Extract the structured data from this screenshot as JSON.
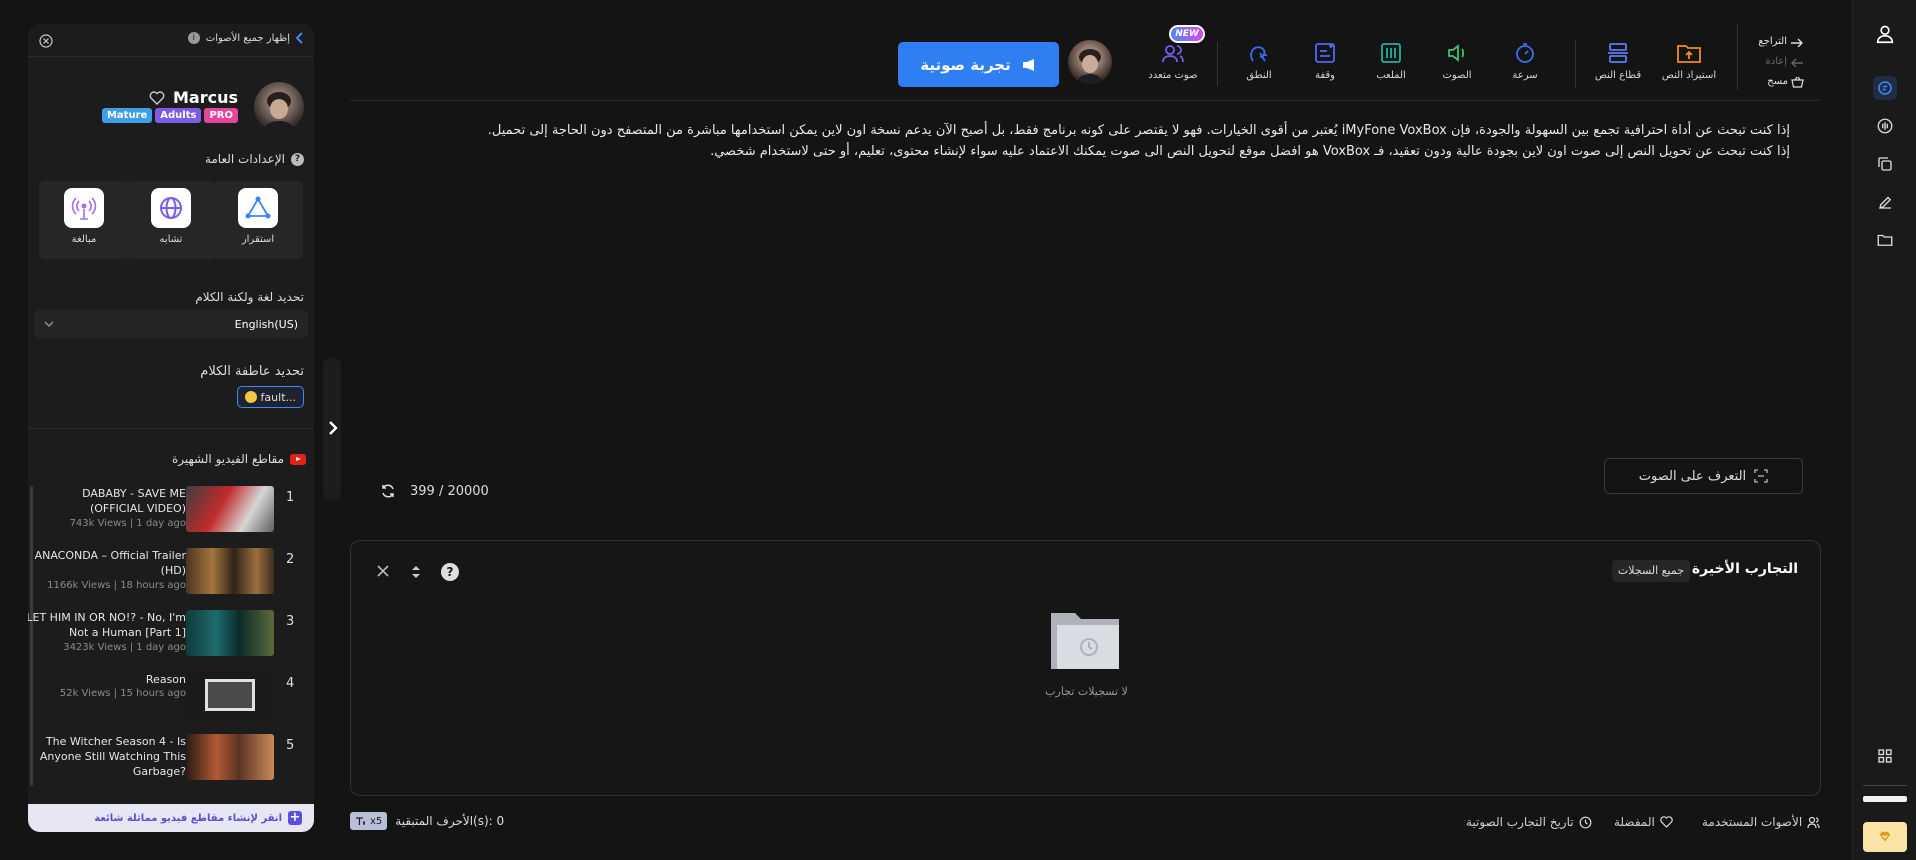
{
  "toolbar": {
    "undo": "التراجع",
    "redo": "إعادة",
    "clear": "مسح",
    "import_text": "استيراد النص",
    "text_segment": "قطاع النص",
    "speed": "سرعة",
    "voice": "الصوت",
    "pitch": "الملعب",
    "pause": "وقفة",
    "pronunciation": "النطق",
    "multi_voice": "صوت متعدد",
    "new_badge": "NEW",
    "try_voice": "تجربة صوتية"
  },
  "editor": {
    "line1": "إذا كنت تبحث عن أداة احترافية تجمع بين السهولة والجودة، فإن iMyFone VoxBox يُعتبر من أقوى الخيارات. فهو لا يقتصر على كونه برنامج فقط، بل أصبح الآن يدعم نسخة اون لاين يمكن استخدامها مباشرة من المتصفح دون الحاجة إلى تحميل.",
    "line2": "إذا كنت تبحث عن تحويل النص إلى صوت اون لاين بجودة عالية ودون تعقيد، فـ VoxBox هو افضل موقع لتحويل النص الى صوت يمكنك الاعتماد عليه سواء لإنشاء محتوى، تعليم، أو حتى لاستخدام شخصي.",
    "char_count": "399 / 20000",
    "recognize": "التعرف على الصوت"
  },
  "recent": {
    "title": "التجارب الأخيرة",
    "filter": "جميع السجلات",
    "empty": "لا تسجيلات تجارب"
  },
  "footer": {
    "remaining": "الأحرف المتبقية(s): 0",
    "x5": "x5",
    "used_voices": "الأصوات المستخدمة",
    "favorites": "المفضلة",
    "history": "تاريخ التجارب الصوتية"
  },
  "panel": {
    "show_all": "إظهار جميع الأصوات",
    "voice_name": "Marcus",
    "badges": [
      "Mature",
      "Adults",
      "PRO"
    ],
    "general_settings": "الإعدادات العامة",
    "settings": [
      "مبالغة",
      "تشابه",
      "استقرار"
    ],
    "lang_label": "تحديد لغة ولكنة الكلام",
    "lang_value": "English(US)",
    "emotion_label": "تحديد عاطفة الكلام",
    "emotion_value": "fault...",
    "videos_title": "مقاطع الفيديو الشهيرة",
    "videos": [
      {
        "num": "1",
        "title": "DABABY - SAVE ME (OFFICIAL VIDEO)",
        "meta": "743k Views | 1 day ago"
      },
      {
        "num": "2",
        "title": "ANACONDA – Official Trailer (HD)",
        "meta": "1166k Views | 18 hours ago"
      },
      {
        "num": "3",
        "title": "LET HIM IN OR NO!? - No, I'm Not a Human [Part 1]",
        "meta": "3423k Views | 1 day ago"
      },
      {
        "num": "4",
        "title": "Reason",
        "meta": "52k Views | 15 hours ago"
      },
      {
        "num": "5",
        "title": "The Witcher Season 4 - Is Anyone Still Watching This Garbage?",
        "meta": ""
      }
    ],
    "create_videos": "انقر لإنشاء مقاطع فيديو مماثلة شائعة"
  },
  "colors": {
    "accent": "#2f7ff3",
    "badge_mature": "#3d9fe8",
    "badge_adults": "#7c5be6",
    "badge_pro": "#e7449b"
  }
}
